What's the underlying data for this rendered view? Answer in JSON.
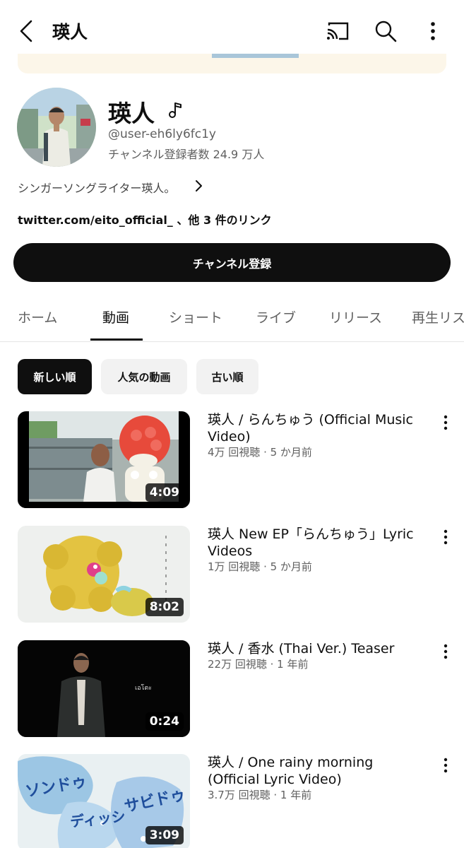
{
  "header": {
    "title": "瑛人"
  },
  "channel": {
    "name": "瑛人",
    "handle": "@user-eh6ly6fc1y",
    "subscribers": "チャンネル登録者数 24.9 万人",
    "description": "シンガーソングライター瑛人。",
    "links": "twitter.com/eito_official_ 、他 3 件のリンク",
    "subscribe_label": "チャンネル登録"
  },
  "tabs": [
    {
      "label": "ホーム"
    },
    {
      "label": "動画"
    },
    {
      "label": "ショート"
    },
    {
      "label": "ライブ"
    },
    {
      "label": "リリース"
    },
    {
      "label": "再生リス"
    }
  ],
  "chips": [
    {
      "label": "新しい順"
    },
    {
      "label": "人気の動画"
    },
    {
      "label": "古い順"
    }
  ],
  "videos": [
    {
      "title": "瑛人 / らんちゅう (Official Music Video)",
      "meta": "4万 回視聴 · 5 か月前",
      "duration": "4:09"
    },
    {
      "title": "瑛人 New EP「らんちゅう」Lyric Videos",
      "meta": "1万 回視聴 · 5 か月前",
      "duration": "8:02"
    },
    {
      "title": "瑛人 / 香水 (Thai Ver.) Teaser",
      "meta": "22万 回視聴 · 1 年前",
      "duration": "0:24",
      "thumb_caption": "เอโตะ"
    },
    {
      "title": "瑛人 / One rainy morning (Official Lyric Video)",
      "meta": "3.7万 回視聴 · 1 年前",
      "duration": "3:09",
      "thumb_text_1": "ソンドゥ",
      "thumb_text_2": "ディッシ",
      "thumb_text_3": "サビドゥ"
    }
  ],
  "colors": {
    "accent": "#0f0f0f",
    "secondary_text": "#606060",
    "chip_bg": "#f2f2f2",
    "banner": "#fcf6e9"
  },
  "icons": [
    "back-arrow-icon",
    "cast-icon",
    "search-icon",
    "more-vert-icon",
    "music-note-icon",
    "chevron-right-icon"
  ]
}
